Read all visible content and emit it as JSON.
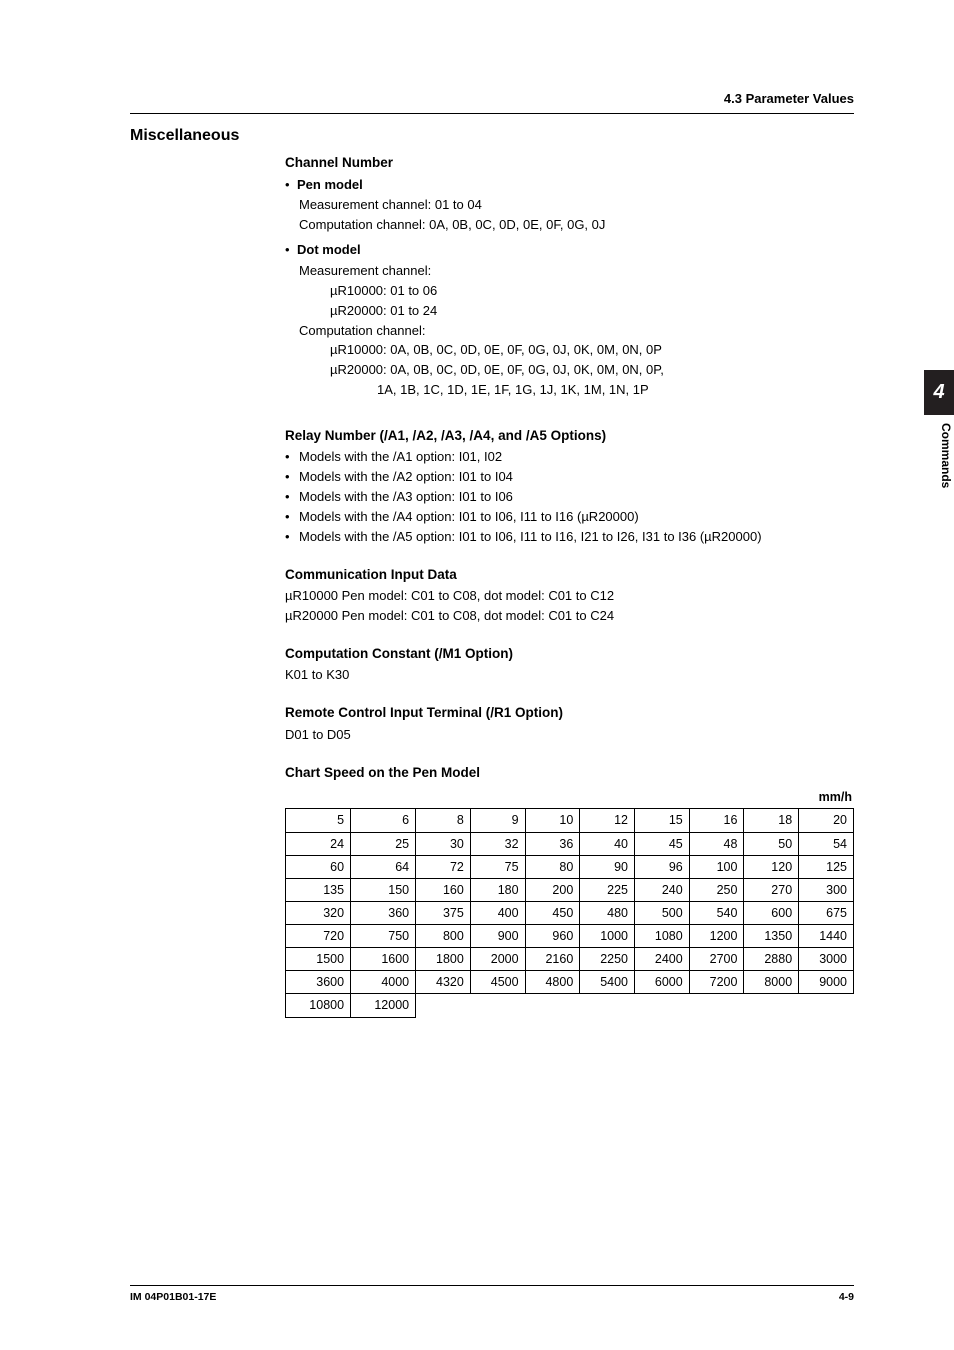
{
  "header": {
    "right": "4.3  Parameter Values"
  },
  "sidetab": {
    "num": "4",
    "label": "Commands"
  },
  "title": "Miscellaneous",
  "channel": {
    "head": "Channel Number",
    "pen": {
      "label": "Pen model",
      "meas": "Measurement channel: 01 to 04",
      "comp": "Computation channel: 0A, 0B, 0C, 0D, 0E, 0F, 0G, 0J"
    },
    "dot": {
      "label": "Dot model",
      "measHead": "Measurement channel:",
      "meas1": "µR10000: 01 to 06",
      "meas2": "µR20000: 01 to 24",
      "compHead": "Computation channel:",
      "comp1": "µR10000: 0A, 0B, 0C, 0D, 0E, 0F, 0G, 0J, 0K, 0M, 0N, 0P",
      "comp2": "µR20000: 0A, 0B, 0C, 0D, 0E, 0F, 0G, 0J, 0K, 0M, 0N, 0P,",
      "comp3": "1A, 1B, 1C, 1D, 1E, 1F, 1G, 1J, 1K, 1M, 1N, 1P"
    }
  },
  "relay": {
    "head": "Relay Number (/A1, /A2, /A3, /A4, and /A5 Options)",
    "items": [
      "Models with the /A1 option: I01, I02",
      "Models with the /A2 option: I01 to I04",
      "Models with the /A3 option: I01 to I06",
      "Models with the /A4 option: I01 to I06, I11 to I16 (µR20000)",
      "Models with the /A5 option: I01 to I06, I11 to I16, I21 to I26, I31 to I36 (µR20000)"
    ]
  },
  "comm": {
    "head": "Communication Input Data",
    "l1": "µR10000   Pen model: C01 to C08, dot model: C01 to C12",
    "l2": "µR20000   Pen model: C01 to C08, dot model: C01 to C24"
  },
  "const": {
    "head": "Computation Constant (/M1 Option)",
    "body": "K01 to K30"
  },
  "remote": {
    "head": "Remote Control Input Terminal (/R1 Option)",
    "body": "D01 to D05"
  },
  "chart": {
    "head": "Chart Speed on the Pen Model",
    "unit": "mm/h"
  },
  "chart_data": {
    "type": "table",
    "title": "Chart Speed on the Pen Model (mm/h)",
    "columns": 10,
    "rows": [
      [
        5,
        6,
        8,
        9,
        10,
        12,
        15,
        16,
        18,
        20
      ],
      [
        24,
        25,
        30,
        32,
        36,
        40,
        45,
        48,
        50,
        54
      ],
      [
        60,
        64,
        72,
        75,
        80,
        90,
        96,
        100,
        120,
        125
      ],
      [
        135,
        150,
        160,
        180,
        200,
        225,
        240,
        250,
        270,
        300
      ],
      [
        320,
        360,
        375,
        400,
        450,
        480,
        500,
        540,
        600,
        675
      ],
      [
        720,
        750,
        800,
        900,
        960,
        1000,
        1080,
        1200,
        1350,
        1440
      ],
      [
        1500,
        1600,
        1800,
        2000,
        2160,
        2250,
        2400,
        2700,
        2880,
        3000
      ],
      [
        3600,
        4000,
        4320,
        4500,
        4800,
        5400,
        6000,
        7200,
        8000,
        9000
      ],
      [
        10800,
        12000,
        null,
        null,
        null,
        null,
        null,
        null,
        null,
        null
      ]
    ]
  },
  "footer": {
    "left": "IM 04P01B01-17E",
    "right": "4-9"
  }
}
